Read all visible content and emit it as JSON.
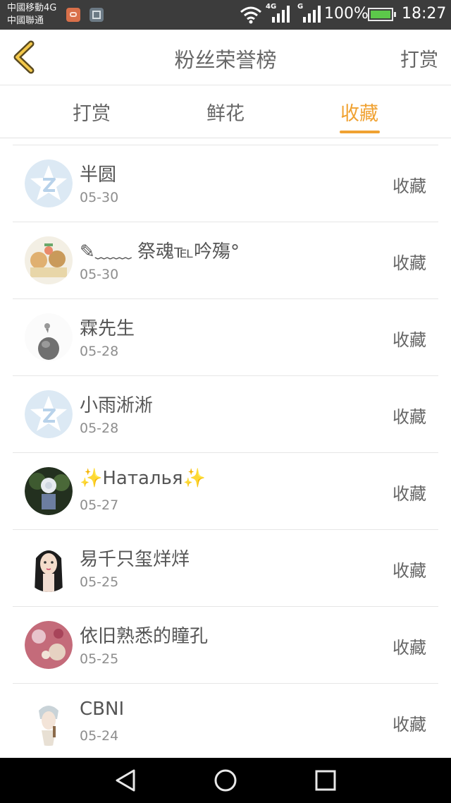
{
  "status_bar": {
    "carrier_line1": "中國移動4G",
    "carrier_line2": "中國聯通",
    "net1": "4G",
    "net2": "G",
    "battery_pct": "100%",
    "battery_level": 1.0,
    "time": "18:27"
  },
  "header": {
    "title": "粉丝荣誉榜",
    "action": "打赏"
  },
  "tabs": [
    {
      "label": "打赏",
      "active": false
    },
    {
      "label": "鲜花",
      "active": false
    },
    {
      "label": "收藏",
      "active": true
    }
  ],
  "colors": {
    "accent": "#f0a232"
  },
  "fans": [
    {
      "name": "半圆",
      "date": "05-30",
      "action": "收藏",
      "avatar": "default-qq-avatar"
    },
    {
      "name": "✎﹏﹏ 祭魂℡吟殤°",
      "date": "05-30",
      "action": "收藏",
      "avatar": "cartoon-avatar"
    },
    {
      "name": "霖先生",
      "date": "05-28",
      "action": "收藏",
      "avatar": "sketch-avatar"
    },
    {
      "name": "小雨淅淅",
      "date": "05-28",
      "action": "收藏",
      "avatar": "default-qq-avatar"
    },
    {
      "name": "✨Наталья✨",
      "date": "05-27",
      "action": "收藏",
      "avatar": "photo-avatar"
    },
    {
      "name": "易千只玺烊烊",
      "date": "05-25",
      "action": "收藏",
      "avatar": "anime-girl-avatar"
    },
    {
      "name": "依旧熟悉的瞳孔",
      "date": "05-25",
      "action": "收藏",
      "avatar": "floral-avatar"
    },
    {
      "name": "CBNI",
      "date": "05-24",
      "action": "收藏",
      "avatar": "anime-boy-avatar"
    }
  ]
}
